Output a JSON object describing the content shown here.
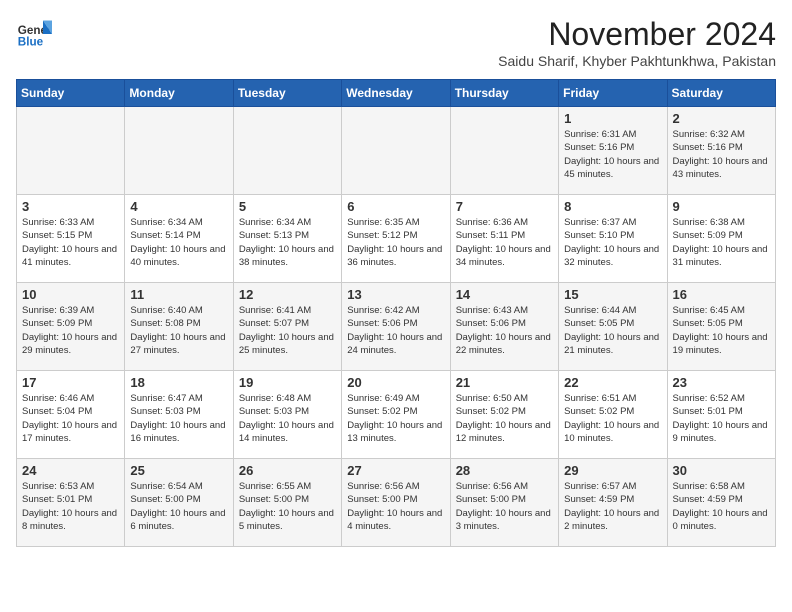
{
  "header": {
    "logo_line1": "General",
    "logo_line2": "Blue",
    "month": "November 2024",
    "location": "Saidu Sharif, Khyber Pakhtunkhwa, Pakistan"
  },
  "days_of_week": [
    "Sunday",
    "Monday",
    "Tuesday",
    "Wednesday",
    "Thursday",
    "Friday",
    "Saturday"
  ],
  "weeks": [
    [
      {
        "day": "",
        "info": ""
      },
      {
        "day": "",
        "info": ""
      },
      {
        "day": "",
        "info": ""
      },
      {
        "day": "",
        "info": ""
      },
      {
        "day": "",
        "info": ""
      },
      {
        "day": "1",
        "info": "Sunrise: 6:31 AM\nSunset: 5:16 PM\nDaylight: 10 hours and 45 minutes."
      },
      {
        "day": "2",
        "info": "Sunrise: 6:32 AM\nSunset: 5:16 PM\nDaylight: 10 hours and 43 minutes."
      }
    ],
    [
      {
        "day": "3",
        "info": "Sunrise: 6:33 AM\nSunset: 5:15 PM\nDaylight: 10 hours and 41 minutes."
      },
      {
        "day": "4",
        "info": "Sunrise: 6:34 AM\nSunset: 5:14 PM\nDaylight: 10 hours and 40 minutes."
      },
      {
        "day": "5",
        "info": "Sunrise: 6:34 AM\nSunset: 5:13 PM\nDaylight: 10 hours and 38 minutes."
      },
      {
        "day": "6",
        "info": "Sunrise: 6:35 AM\nSunset: 5:12 PM\nDaylight: 10 hours and 36 minutes."
      },
      {
        "day": "7",
        "info": "Sunrise: 6:36 AM\nSunset: 5:11 PM\nDaylight: 10 hours and 34 minutes."
      },
      {
        "day": "8",
        "info": "Sunrise: 6:37 AM\nSunset: 5:10 PM\nDaylight: 10 hours and 32 minutes."
      },
      {
        "day": "9",
        "info": "Sunrise: 6:38 AM\nSunset: 5:09 PM\nDaylight: 10 hours and 31 minutes."
      }
    ],
    [
      {
        "day": "10",
        "info": "Sunrise: 6:39 AM\nSunset: 5:09 PM\nDaylight: 10 hours and 29 minutes."
      },
      {
        "day": "11",
        "info": "Sunrise: 6:40 AM\nSunset: 5:08 PM\nDaylight: 10 hours and 27 minutes."
      },
      {
        "day": "12",
        "info": "Sunrise: 6:41 AM\nSunset: 5:07 PM\nDaylight: 10 hours and 25 minutes."
      },
      {
        "day": "13",
        "info": "Sunrise: 6:42 AM\nSunset: 5:06 PM\nDaylight: 10 hours and 24 minutes."
      },
      {
        "day": "14",
        "info": "Sunrise: 6:43 AM\nSunset: 5:06 PM\nDaylight: 10 hours and 22 minutes."
      },
      {
        "day": "15",
        "info": "Sunrise: 6:44 AM\nSunset: 5:05 PM\nDaylight: 10 hours and 21 minutes."
      },
      {
        "day": "16",
        "info": "Sunrise: 6:45 AM\nSunset: 5:05 PM\nDaylight: 10 hours and 19 minutes."
      }
    ],
    [
      {
        "day": "17",
        "info": "Sunrise: 6:46 AM\nSunset: 5:04 PM\nDaylight: 10 hours and 17 minutes."
      },
      {
        "day": "18",
        "info": "Sunrise: 6:47 AM\nSunset: 5:03 PM\nDaylight: 10 hours and 16 minutes."
      },
      {
        "day": "19",
        "info": "Sunrise: 6:48 AM\nSunset: 5:03 PM\nDaylight: 10 hours and 14 minutes."
      },
      {
        "day": "20",
        "info": "Sunrise: 6:49 AM\nSunset: 5:02 PM\nDaylight: 10 hours and 13 minutes."
      },
      {
        "day": "21",
        "info": "Sunrise: 6:50 AM\nSunset: 5:02 PM\nDaylight: 10 hours and 12 minutes."
      },
      {
        "day": "22",
        "info": "Sunrise: 6:51 AM\nSunset: 5:02 PM\nDaylight: 10 hours and 10 minutes."
      },
      {
        "day": "23",
        "info": "Sunrise: 6:52 AM\nSunset: 5:01 PM\nDaylight: 10 hours and 9 minutes."
      }
    ],
    [
      {
        "day": "24",
        "info": "Sunrise: 6:53 AM\nSunset: 5:01 PM\nDaylight: 10 hours and 8 minutes."
      },
      {
        "day": "25",
        "info": "Sunrise: 6:54 AM\nSunset: 5:00 PM\nDaylight: 10 hours and 6 minutes."
      },
      {
        "day": "26",
        "info": "Sunrise: 6:55 AM\nSunset: 5:00 PM\nDaylight: 10 hours and 5 minutes."
      },
      {
        "day": "27",
        "info": "Sunrise: 6:56 AM\nSunset: 5:00 PM\nDaylight: 10 hours and 4 minutes."
      },
      {
        "day": "28",
        "info": "Sunrise: 6:56 AM\nSunset: 5:00 PM\nDaylight: 10 hours and 3 minutes."
      },
      {
        "day": "29",
        "info": "Sunrise: 6:57 AM\nSunset: 4:59 PM\nDaylight: 10 hours and 2 minutes."
      },
      {
        "day": "30",
        "info": "Sunrise: 6:58 AM\nSunset: 4:59 PM\nDaylight: 10 hours and 0 minutes."
      }
    ]
  ]
}
